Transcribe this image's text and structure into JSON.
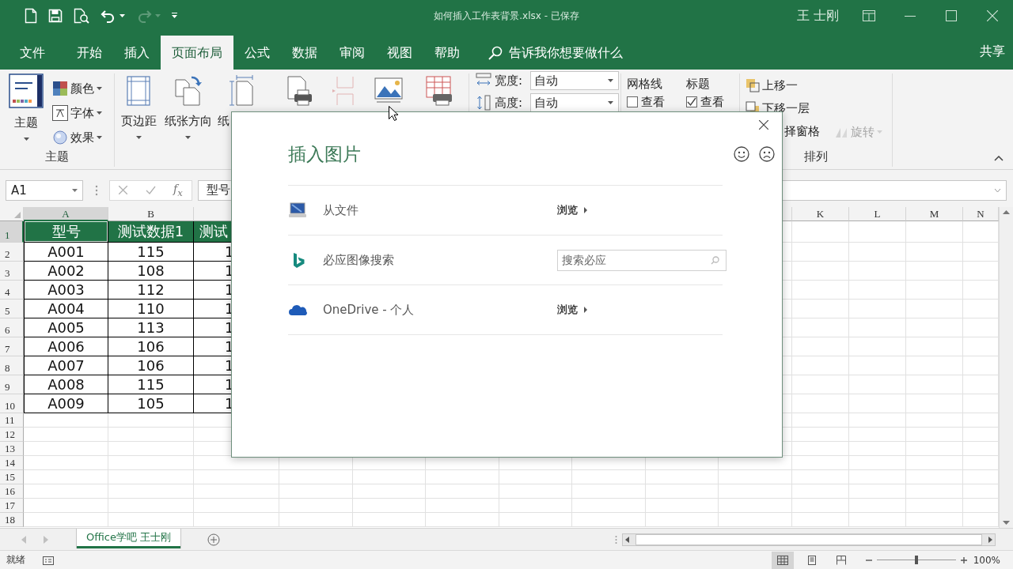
{
  "window": {
    "title": "如何插入工作表背景.xlsx - 已保存",
    "user": "王 士刚"
  },
  "ribbon_tabs": [
    {
      "label": "文件",
      "selected": false
    },
    {
      "label": "开始",
      "selected": false
    },
    {
      "label": "插入",
      "selected": false
    },
    {
      "label": "页面布局",
      "selected": true
    },
    {
      "label": "公式",
      "selected": false
    },
    {
      "label": "数据",
      "selected": false
    },
    {
      "label": "审阅",
      "selected": false
    },
    {
      "label": "视图",
      "selected": false
    },
    {
      "label": "帮助",
      "selected": false
    }
  ],
  "tell_me": {
    "placeholder": "告诉我你想要做什么"
  },
  "share": "共享",
  "ribbon": {
    "themes": {
      "group_label": "主题",
      "button": "主题",
      "items": [
        {
          "kind": "colors",
          "label": "颜色"
        },
        {
          "kind": "fonts",
          "label": "字体"
        },
        {
          "kind": "effects",
          "label": "效果"
        }
      ]
    },
    "page_setup": [
      {
        "kind": "margins",
        "label": "页边距",
        "disabled": false
      },
      {
        "kind": "orientation",
        "label": "纸张方向",
        "disabled": false
      },
      {
        "kind": "size",
        "label": "纸",
        "disabled": false
      },
      {
        "kind": "print_area",
        "disabled": false
      },
      {
        "kind": "breaks",
        "disabled": true
      },
      {
        "kind": "background",
        "disabled": false
      },
      {
        "kind": "print_titles",
        "disabled": false
      }
    ],
    "scale": [
      {
        "kind": "width",
        "label": "宽度:",
        "value": "自动"
      },
      {
        "kind": "height",
        "label": "高度:",
        "value": "自动"
      }
    ],
    "sheet_options": [
      {
        "title": "网格线",
        "option": "查看",
        "checked": false
      },
      {
        "title": "标题",
        "option": "查看",
        "checked": true
      }
    ],
    "arrange": {
      "group_label": "排列",
      "items": [
        {
          "kind": "bring_forward",
          "label": "上移一",
          "disabled": false
        },
        {
          "kind": "send_backward",
          "label": "下移一层",
          "disabled": false
        },
        {
          "kind": "selection_pane",
          "label": "择窗格",
          "disabled": false
        },
        {
          "kind": "rotate",
          "label": "旋转",
          "disabled": true
        }
      ]
    }
  },
  "formula_bar": {
    "name_box": "A1",
    "function_label": "f$_{x}$",
    "content": "型号"
  },
  "sheet": {
    "left_columns": [
      {
        "label": "A",
        "selected": true
      },
      {
        "label": "B",
        "selected": false
      }
    ],
    "right_columns": [
      {
        "label": "K",
        "selected": false
      },
      {
        "label": "L",
        "selected": false
      },
      {
        "label": "M",
        "selected": false
      },
      {
        "label": "N",
        "selected": false
      }
    ],
    "rows": [
      {
        "number": "1",
        "kind": "header",
        "selected": true,
        "cells": [
          "型号",
          "测试数据1",
          "测试"
        ]
      },
      {
        "number": "2",
        "kind": "data",
        "selected": false,
        "cells": [
          "A001",
          "115",
          "1"
        ]
      },
      {
        "number": "3",
        "kind": "data",
        "selected": false,
        "cells": [
          "A002",
          "108",
          "1"
        ]
      },
      {
        "number": "4",
        "kind": "data",
        "selected": false,
        "cells": [
          "A003",
          "112",
          "1"
        ]
      },
      {
        "number": "5",
        "kind": "data",
        "selected": false,
        "cells": [
          "A004",
          "110",
          "1"
        ]
      },
      {
        "number": "6",
        "kind": "data",
        "selected": false,
        "cells": [
          "A005",
          "113",
          "1"
        ]
      },
      {
        "number": "7",
        "kind": "data",
        "selected": false,
        "cells": [
          "A006",
          "106",
          "1"
        ]
      },
      {
        "number": "8",
        "kind": "data",
        "selected": false,
        "cells": [
          "A007",
          "106",
          "1"
        ]
      },
      {
        "number": "9",
        "kind": "data",
        "selected": false,
        "cells": [
          "A008",
          "115",
          "1"
        ]
      },
      {
        "number": "10",
        "kind": "data",
        "selected": false,
        "cells": [
          "A009",
          "105",
          "1"
        ]
      },
      {
        "number": "11",
        "kind": "empty",
        "selected": false
      },
      {
        "number": "12",
        "kind": "empty",
        "selected": false
      },
      {
        "number": "13",
        "kind": "empty",
        "selected": false
      },
      {
        "number": "14",
        "kind": "empty",
        "selected": false
      },
      {
        "number": "15",
        "kind": "empty",
        "selected": false
      },
      {
        "number": "16",
        "kind": "empty",
        "selected": false
      },
      {
        "number": "17",
        "kind": "empty",
        "selected": false
      },
      {
        "number": "18",
        "kind": "empty",
        "selected": false
      }
    ]
  },
  "sheet_tabs": [
    {
      "label": "Office学吧 王士刚",
      "selected": true
    }
  ],
  "status_bar": {
    "status": "就绪",
    "views": [
      {
        "kind": "normal",
        "selected": true
      },
      {
        "kind": "page_layout",
        "selected": false
      },
      {
        "kind": "page_break",
        "selected": false
      }
    ],
    "zoom": {
      "level": 0.5,
      "reading": "100%"
    }
  },
  "dialog": {
    "title": "插入图片",
    "sources": [
      {
        "kind": "file",
        "label": "从文件",
        "action": "浏览"
      },
      {
        "kind": "bing",
        "label": "必应图像搜索",
        "placeholder": "搜索必应"
      },
      {
        "kind": "onedrive",
        "label": "OneDrive - 个人",
        "action": "浏览"
      }
    ]
  }
}
